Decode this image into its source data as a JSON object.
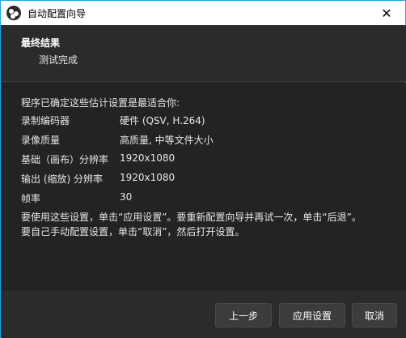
{
  "window": {
    "title": "自动配置向导"
  },
  "header": {
    "title": "最终结果",
    "subtitle": "测试完成"
  },
  "content": {
    "intro": "程序已确定这些估计设置是最适合你:",
    "settings": [
      {
        "label": "录制编码器",
        "value": "硬件 (QSV, H.264)"
      },
      {
        "label": "录像质量",
        "value": "高质量, 中等文件大小"
      },
      {
        "label": "基础（画布）分辨率",
        "value": "1920x1080"
      },
      {
        "label": "输出 (缩放) 分辨率",
        "value": "1920x1080"
      },
      {
        "label": "帧率",
        "value": "30"
      }
    ],
    "note_line1": "要使用这些设置，单击“应用设置”。要重新配置向导并再试一次，单击“后退”。",
    "note_line2": "要自己手动配置设置，单击“取消”，然后打开设置。"
  },
  "buttons": {
    "back": "上一步",
    "apply": "应用设置",
    "cancel": "取消"
  },
  "icons": {
    "app": "obs-app-icon",
    "close": "close-icon"
  },
  "colors": {
    "accent_border": "#1aa3e8",
    "background": "#2b2b2b",
    "content_background": "#232323"
  }
}
